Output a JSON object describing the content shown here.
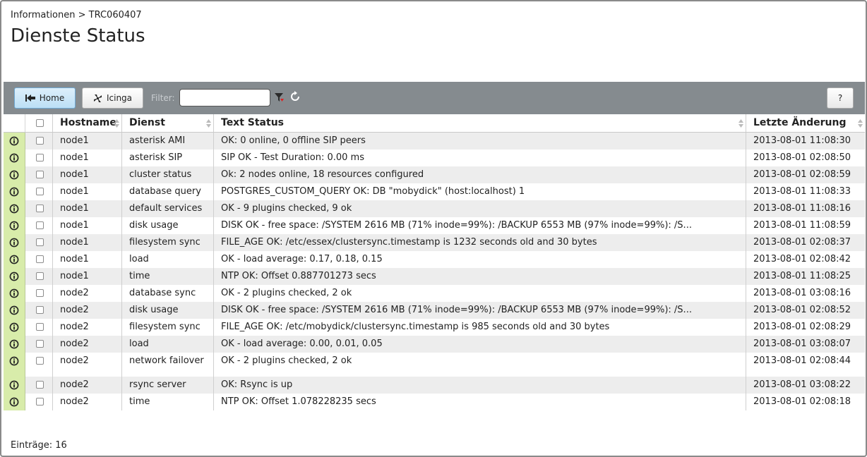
{
  "breadcrumb": "Informationen > TRC060407",
  "title": "Dienste Status",
  "toolbar": {
    "home_label": "Home",
    "icinga_label": "Icinga",
    "filter_label": "Filter:",
    "filter_value": "",
    "help_label": "?"
  },
  "table": {
    "columns": [
      "Hostname",
      "Dienst",
      "Text Status",
      "Letzte Änderung"
    ],
    "rows": [
      {
        "host": "node1",
        "service": "asterisk AMI",
        "text": "OK: 0 online, 0 offline SIP peers",
        "changed": "2013-08-01 11:08:30"
      },
      {
        "host": "node1",
        "service": "asterisk SIP",
        "text": "SIP OK - Test Duration: 0.00 ms",
        "changed": "2013-08-01 02:08:50"
      },
      {
        "host": "node1",
        "service": "cluster status",
        "text": "Ok: 2 nodes online, 18 resources configured",
        "changed": "2013-08-01 02:08:59"
      },
      {
        "host": "node1",
        "service": "database query",
        "text": "POSTGRES_CUSTOM_QUERY OK: DB \"mobydick\" (host:localhost) 1",
        "changed": "2013-08-01 11:08:33"
      },
      {
        "host": "node1",
        "service": "default services",
        "text": "OK - 9 plugins checked, 9 ok",
        "changed": "2013-08-01 11:08:16"
      },
      {
        "host": "node1",
        "service": "disk usage",
        "text": "DISK OK - free space: /SYSTEM 2616 MB (71% inode=99%): /BACKUP 6553 MB (97% inode=99%): /S...",
        "changed": "2013-08-01 11:08:59"
      },
      {
        "host": "node1",
        "service": "filesystem sync",
        "text": "FILE_AGE OK: /etc/essex/clustersync.timestamp is 1232 seconds old and 30 bytes",
        "changed": "2013-08-01 02:08:37"
      },
      {
        "host": "node1",
        "service": "load",
        "text": "OK - load average: 0.17, 0.18, 0.15",
        "changed": "2013-08-01 02:08:42"
      },
      {
        "host": "node1",
        "service": "time",
        "text": "NTP OK: Offset 0.887701273 secs",
        "changed": "2013-08-01 11:08:25"
      },
      {
        "host": "node2",
        "service": "database sync",
        "text": "OK - 2 plugins checked, 2 ok",
        "changed": "2013-08-01 03:08:16"
      },
      {
        "host": "node2",
        "service": "disk usage",
        "text": "DISK OK - free space: /SYSTEM 2616 MB (71% inode=99%): /BACKUP 6553 MB (97% inode=99%): /S...",
        "changed": "2013-08-01 02:08:52"
      },
      {
        "host": "node2",
        "service": "filesystem sync",
        "text": "FILE_AGE OK: /etc/mobydick/clustersync.timestamp is 985 seconds old and 30 bytes",
        "changed": "2013-08-01 02:08:29"
      },
      {
        "host": "node2",
        "service": "load",
        "text": "OK - load average: 0.00, 0.01, 0.05",
        "changed": "2013-08-01 03:08:07"
      },
      {
        "host": "node2",
        "service": "network failover",
        "text": "OK - 2 plugins checked, 2 ok",
        "changed": "2013-08-01 02:08:44"
      },
      {
        "host": "node2",
        "service": "rsync server",
        "text": "OK: Rsync is up",
        "changed": "2013-08-01 03:08:22"
      },
      {
        "host": "node2",
        "service": "time",
        "text": "NTP OK: Offset 1.078228235 secs",
        "changed": "2013-08-01 02:08:18"
      }
    ]
  },
  "footer": "Einträge: 16",
  "colors": {
    "toolbar": "#858b8f",
    "status_ok": "#d8ecaa",
    "row_alt": "#ededed"
  },
  "icons": {
    "home": "home-icon",
    "icinga": "icinga-icon",
    "filter": "filter-icon",
    "refresh": "refresh-icon",
    "status": "info-icon"
  }
}
